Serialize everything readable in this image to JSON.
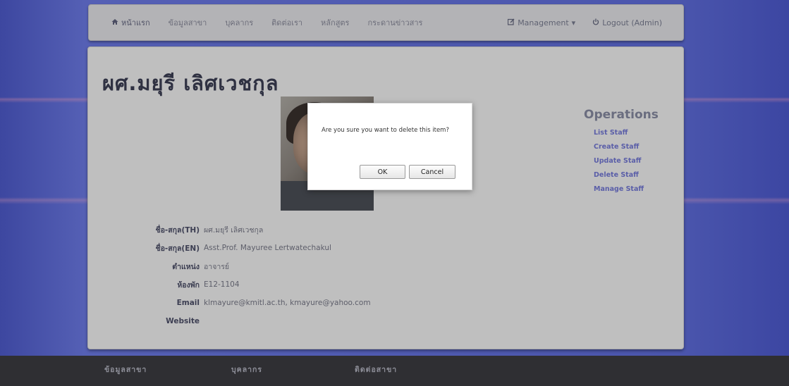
{
  "nav": {
    "home": "หน้าแรก",
    "items": [
      "ข้อมูลสาขา",
      "บุคลากร",
      "ติดต่อเรา",
      "หลักสูตร",
      "กระดานข่าวสาร"
    ],
    "management": "Management",
    "logout": "Logout (Admin)"
  },
  "page": {
    "title": "ผศ.มยุรี เลิศเวชกุล"
  },
  "operations": {
    "heading": "Operations",
    "items": [
      "List Staff",
      "Create Staff",
      "Update Staff",
      "Delete Staff",
      "Manage Staff"
    ]
  },
  "details": [
    {
      "label": "ชื่อ-สกุล(TH)",
      "value": "ผศ.มยุรี เลิศเวชกุล"
    },
    {
      "label": "ชื่อ-สกุล(EN)",
      "value": "Asst.Prof. Mayuree Lertwatechakul"
    },
    {
      "label": "ตำแหน่ง",
      "value": "อาจารย์"
    },
    {
      "label": "ห้องพัก",
      "value": "E12-1104"
    },
    {
      "label": "Email",
      "value": "klmayure@kmitl.ac.th, kmayure@yahoo.com"
    },
    {
      "label": "Website",
      "value": ""
    }
  ],
  "dialog": {
    "message": "Are you sure you want to delete this item?",
    "ok": "OK",
    "cancel": "Cancel"
  },
  "footer": {
    "columns": [
      "ข้อมูลสาขา",
      "บุคลากร",
      "ติดต่อสาขา"
    ]
  }
}
